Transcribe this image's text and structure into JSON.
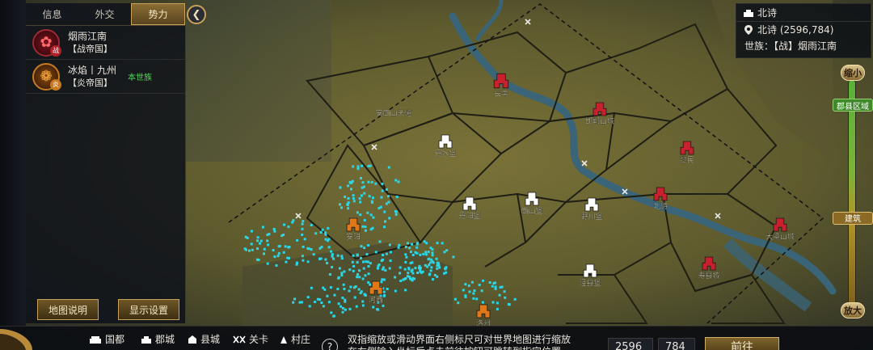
{
  "tabs": [
    {
      "label": "信息"
    },
    {
      "label": "外交"
    },
    {
      "label": "势力"
    }
  ],
  "factions": [
    {
      "name": "烟雨江南",
      "type": "【战帝国】",
      "badge_char": "战",
      "color": "#9b2a35"
    },
    {
      "name": "冰焰丨九州",
      "type": "【炎帝国】",
      "badge_char": "炎",
      "color": "#c47a22",
      "own_label": "本世族"
    }
  ],
  "buttons": {
    "map_help": "地图说明",
    "display_settings": "显示设置",
    "goto": "前往"
  },
  "location_info": {
    "title": "北诗",
    "coords": "北诗 (2596,784)",
    "clan": "世族：【战】烟雨江南"
  },
  "zoom": {
    "shrink_label": "缩小",
    "enlarge_label": "放大",
    "level_region": "郡县区域",
    "level_building": "建筑",
    "position": 0.6
  },
  "legend": [
    {
      "label": "国都",
      "icon": "capital-icon"
    },
    {
      "label": "郡城",
      "icon": "prefecture-icon"
    },
    {
      "label": "县城",
      "icon": "county-icon"
    },
    {
      "label": "关卡",
      "icon": "pass-icon"
    },
    {
      "label": "村庄",
      "icon": "village-icon"
    }
  ],
  "tip_text": "双指缩放或滑动界面右侧标尺可对世界地图进行缩放\n在右侧输入坐标后点击前往按钮可跳转到指定位置",
  "coord_inputs": {
    "x": "2596",
    "y": "784"
  },
  "map_labels": [
    {
      "name": "长平"
    },
    {
      "name": "邯郸山城"
    },
    {
      "name": "黎民"
    },
    {
      "name": "北诗"
    },
    {
      "name": "大梁山城"
    },
    {
      "name": "寿县城"
    },
    {
      "name": "丹水堡"
    },
    {
      "name": "丹阳堡"
    },
    {
      "name": "西山堡"
    },
    {
      "name": "野川堡"
    },
    {
      "name": "泾县堡"
    },
    {
      "name": "安西山关道"
    },
    {
      "name": "安阳"
    },
    {
      "name": "河西"
    },
    {
      "name": "洛州"
    }
  ],
  "colors": {
    "enemy_city": "#c8202c",
    "neutral_city": "#ffffff",
    "own_city": "#e07818",
    "troops": "#28d8e8",
    "gold_border": "#c9a25a"
  }
}
